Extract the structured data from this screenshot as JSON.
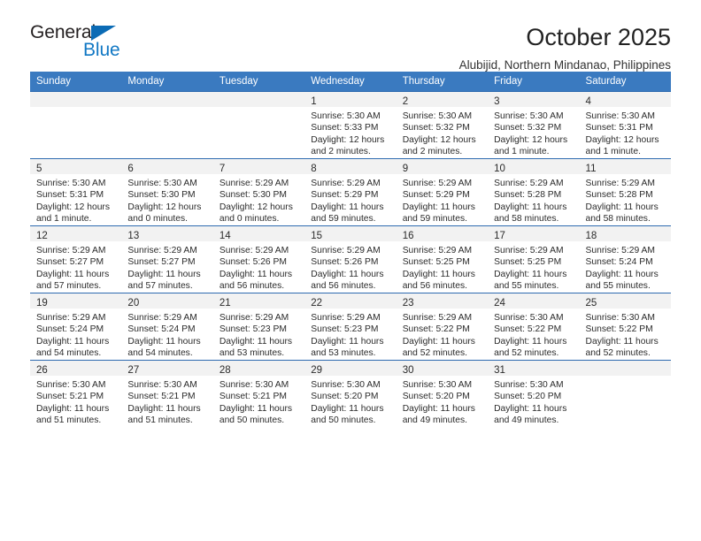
{
  "brand": {
    "name_dark": "General",
    "name_blue": "Blue",
    "accent_color": "#1178c4",
    "triangle_color": "#0b6bb5"
  },
  "header": {
    "title": "October 2025",
    "subtitle": "Alubijid, Northern Mindanao, Philippines"
  },
  "theme": {
    "header_band": "#3a7ac0",
    "daynum_band": "#f2f2f2",
    "grid_line": "#2e6bb0",
    "text": "#2b2b2b"
  },
  "weekdays": [
    "Sunday",
    "Monday",
    "Tuesday",
    "Wednesday",
    "Thursday",
    "Friday",
    "Saturday"
  ],
  "weeks": [
    [
      {
        "day": "",
        "lines": []
      },
      {
        "day": "",
        "lines": []
      },
      {
        "day": "",
        "lines": []
      },
      {
        "day": "1",
        "lines": [
          "Sunrise: 5:30 AM",
          "Sunset: 5:33 PM",
          "Daylight: 12 hours",
          "and 2 minutes."
        ]
      },
      {
        "day": "2",
        "lines": [
          "Sunrise: 5:30 AM",
          "Sunset: 5:32 PM",
          "Daylight: 12 hours",
          "and 2 minutes."
        ]
      },
      {
        "day": "3",
        "lines": [
          "Sunrise: 5:30 AM",
          "Sunset: 5:32 PM",
          "Daylight: 12 hours",
          "and 1 minute."
        ]
      },
      {
        "day": "4",
        "lines": [
          "Sunrise: 5:30 AM",
          "Sunset: 5:31 PM",
          "Daylight: 12 hours",
          "and 1 minute."
        ]
      }
    ],
    [
      {
        "day": "5",
        "lines": [
          "Sunrise: 5:30 AM",
          "Sunset: 5:31 PM",
          "Daylight: 12 hours",
          "and 1 minute."
        ]
      },
      {
        "day": "6",
        "lines": [
          "Sunrise: 5:30 AM",
          "Sunset: 5:30 PM",
          "Daylight: 12 hours",
          "and 0 minutes."
        ]
      },
      {
        "day": "7",
        "lines": [
          "Sunrise: 5:29 AM",
          "Sunset: 5:30 PM",
          "Daylight: 12 hours",
          "and 0 minutes."
        ]
      },
      {
        "day": "8",
        "lines": [
          "Sunrise: 5:29 AM",
          "Sunset: 5:29 PM",
          "Daylight: 11 hours",
          "and 59 minutes."
        ]
      },
      {
        "day": "9",
        "lines": [
          "Sunrise: 5:29 AM",
          "Sunset: 5:29 PM",
          "Daylight: 11 hours",
          "and 59 minutes."
        ]
      },
      {
        "day": "10",
        "lines": [
          "Sunrise: 5:29 AM",
          "Sunset: 5:28 PM",
          "Daylight: 11 hours",
          "and 58 minutes."
        ]
      },
      {
        "day": "11",
        "lines": [
          "Sunrise: 5:29 AM",
          "Sunset: 5:28 PM",
          "Daylight: 11 hours",
          "and 58 minutes."
        ]
      }
    ],
    [
      {
        "day": "12",
        "lines": [
          "Sunrise: 5:29 AM",
          "Sunset: 5:27 PM",
          "Daylight: 11 hours",
          "and 57 minutes."
        ]
      },
      {
        "day": "13",
        "lines": [
          "Sunrise: 5:29 AM",
          "Sunset: 5:27 PM",
          "Daylight: 11 hours",
          "and 57 minutes."
        ]
      },
      {
        "day": "14",
        "lines": [
          "Sunrise: 5:29 AM",
          "Sunset: 5:26 PM",
          "Daylight: 11 hours",
          "and 56 minutes."
        ]
      },
      {
        "day": "15",
        "lines": [
          "Sunrise: 5:29 AM",
          "Sunset: 5:26 PM",
          "Daylight: 11 hours",
          "and 56 minutes."
        ]
      },
      {
        "day": "16",
        "lines": [
          "Sunrise: 5:29 AM",
          "Sunset: 5:25 PM",
          "Daylight: 11 hours",
          "and 56 minutes."
        ]
      },
      {
        "day": "17",
        "lines": [
          "Sunrise: 5:29 AM",
          "Sunset: 5:25 PM",
          "Daylight: 11 hours",
          "and 55 minutes."
        ]
      },
      {
        "day": "18",
        "lines": [
          "Sunrise: 5:29 AM",
          "Sunset: 5:24 PM",
          "Daylight: 11 hours",
          "and 55 minutes."
        ]
      }
    ],
    [
      {
        "day": "19",
        "lines": [
          "Sunrise: 5:29 AM",
          "Sunset: 5:24 PM",
          "Daylight: 11 hours",
          "and 54 minutes."
        ]
      },
      {
        "day": "20",
        "lines": [
          "Sunrise: 5:29 AM",
          "Sunset: 5:24 PM",
          "Daylight: 11 hours",
          "and 54 minutes."
        ]
      },
      {
        "day": "21",
        "lines": [
          "Sunrise: 5:29 AM",
          "Sunset: 5:23 PM",
          "Daylight: 11 hours",
          "and 53 minutes."
        ]
      },
      {
        "day": "22",
        "lines": [
          "Sunrise: 5:29 AM",
          "Sunset: 5:23 PM",
          "Daylight: 11 hours",
          "and 53 minutes."
        ]
      },
      {
        "day": "23",
        "lines": [
          "Sunrise: 5:29 AM",
          "Sunset: 5:22 PM",
          "Daylight: 11 hours",
          "and 52 minutes."
        ]
      },
      {
        "day": "24",
        "lines": [
          "Sunrise: 5:30 AM",
          "Sunset: 5:22 PM",
          "Daylight: 11 hours",
          "and 52 minutes."
        ]
      },
      {
        "day": "25",
        "lines": [
          "Sunrise: 5:30 AM",
          "Sunset: 5:22 PM",
          "Daylight: 11 hours",
          "and 52 minutes."
        ]
      }
    ],
    [
      {
        "day": "26",
        "lines": [
          "Sunrise: 5:30 AM",
          "Sunset: 5:21 PM",
          "Daylight: 11 hours",
          "and 51 minutes."
        ]
      },
      {
        "day": "27",
        "lines": [
          "Sunrise: 5:30 AM",
          "Sunset: 5:21 PM",
          "Daylight: 11 hours",
          "and 51 minutes."
        ]
      },
      {
        "day": "28",
        "lines": [
          "Sunrise: 5:30 AM",
          "Sunset: 5:21 PM",
          "Daylight: 11 hours",
          "and 50 minutes."
        ]
      },
      {
        "day": "29",
        "lines": [
          "Sunrise: 5:30 AM",
          "Sunset: 5:20 PM",
          "Daylight: 11 hours",
          "and 50 minutes."
        ]
      },
      {
        "day": "30",
        "lines": [
          "Sunrise: 5:30 AM",
          "Sunset: 5:20 PM",
          "Daylight: 11 hours",
          "and 49 minutes."
        ]
      },
      {
        "day": "31",
        "lines": [
          "Sunrise: 5:30 AM",
          "Sunset: 5:20 PM",
          "Daylight: 11 hours",
          "and 49 minutes."
        ]
      },
      {
        "day": "",
        "lines": []
      }
    ]
  ]
}
